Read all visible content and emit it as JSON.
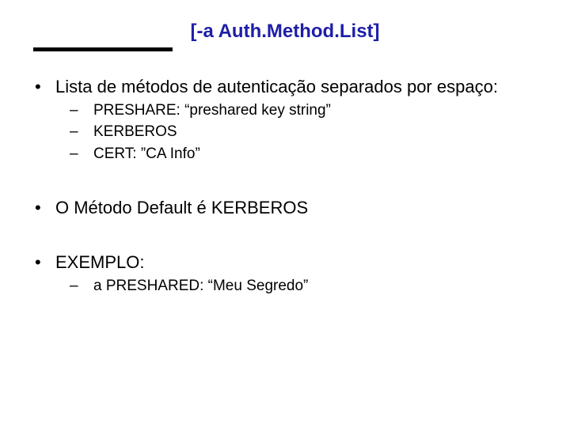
{
  "title": "[-a Auth.Method.List]",
  "bullets": {
    "b1": {
      "text": "Lista de métodos de autenticação separados por espaço:",
      "sub": [
        "PRESHARE: “preshared key string”",
        "KERBEROS",
        "CERT: ”CA Info”"
      ]
    },
    "b2": {
      "text": "O Método Default é KERBEROS"
    },
    "b3": {
      "text": "EXEMPLO:",
      "sub": [
        "a PRESHARED: “Meu Segredo”"
      ]
    }
  }
}
